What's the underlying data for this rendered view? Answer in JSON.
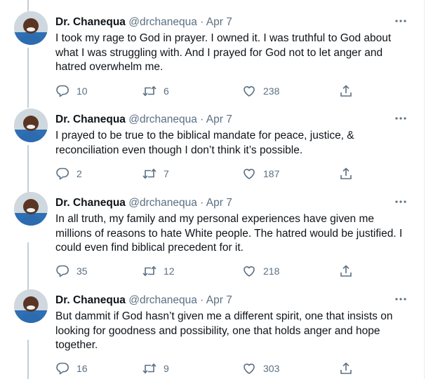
{
  "tweets": [
    {
      "name": "Dr. Chanequa",
      "handle": "@drchanequa",
      "separator": "·",
      "date": "Apr 7",
      "text": "I took my rage to God in prayer. I owned it. I was truthful to God about what I was struggling with. And I prayed for God not to let anger and hatred overwhelm me.",
      "replies": "10",
      "retweets": "6",
      "likes": "238"
    },
    {
      "name": "Dr. Chanequa",
      "handle": "@drchanequa",
      "separator": "·",
      "date": "Apr 7",
      "text": "I prayed to be true to the biblical mandate for peace, justice, & reconciliation even though I don’t think it’s possible.",
      "replies": "2",
      "retweets": "7",
      "likes": "187"
    },
    {
      "name": "Dr. Chanequa",
      "handle": "@drchanequa",
      "separator": "·",
      "date": "Apr 7",
      "text": "In all truth, my family and my personal experiences have given me millions of reasons to hate White people. The hatred would be justified. I could even find biblical precedent for it.",
      "replies": "35",
      "retweets": "12",
      "likes": "218"
    },
    {
      "name": "Dr. Chanequa",
      "handle": "@drchanequa",
      "separator": "·",
      "date": "Apr 7",
      "text": "But dammit if God hasn’t given me a different spirit, one that insists on looking for goodness and possibility, one that holds anger and hope together.",
      "replies": "16",
      "retweets": "9",
      "likes": "303"
    }
  ],
  "icons": {
    "more": "more-icon",
    "reply": "reply-icon",
    "retweet": "retweet-icon",
    "like": "like-icon",
    "share": "share-icon"
  },
  "colors": {
    "text": "#0f1419",
    "secondary": "#5b7083",
    "thread_line": "#c4cfd6",
    "border": "#e6ecf0"
  }
}
